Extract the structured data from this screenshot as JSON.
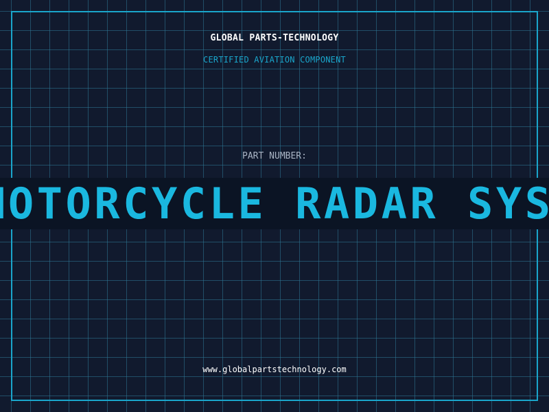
{
  "header": {
    "company": "GLOBAL PARTS-TECHNOLOGY",
    "tagline": "CERTIFIED AVIATION COMPONENT"
  },
  "part": {
    "label": "PART NUMBER:",
    "value": "MOTORCYCLE RADAR SYSTEM"
  },
  "footer": {
    "website": "www.globalpartstechnology.com"
  },
  "colors": {
    "background": "#111a2e",
    "accent": "#1aa6cc",
    "grid": "#2e7896",
    "band": "#0b1424"
  }
}
